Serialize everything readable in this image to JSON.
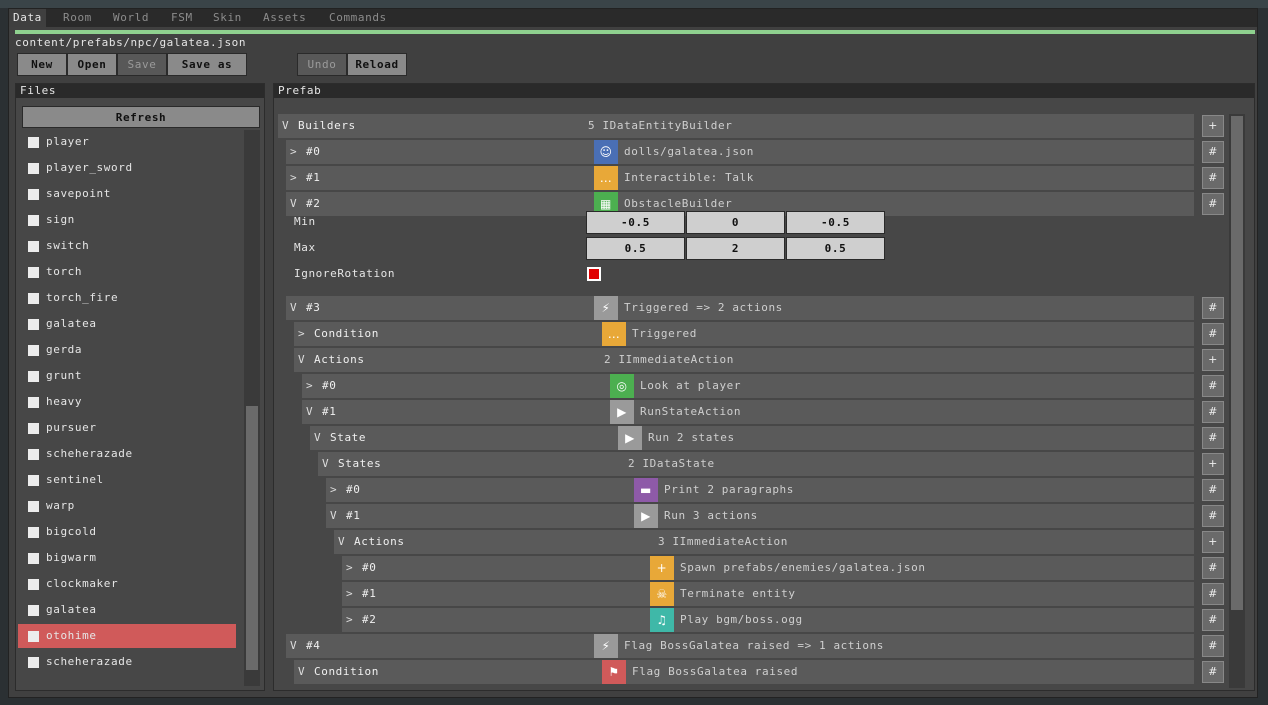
{
  "menu": [
    "Data",
    "Room",
    "World",
    "FSM",
    "Skin",
    "Assets",
    "Commands"
  ],
  "progress": 1.0,
  "path": "content/prefabs/npc/galatea.json",
  "toolbar": {
    "new": "New",
    "open": "Open",
    "save": "Save",
    "save_as": "Save as",
    "undo": "Undo",
    "reload": "Reload"
  },
  "files": {
    "title": "Files",
    "refresh": "Refresh",
    "items": [
      "player",
      "player_sword",
      "savepoint",
      "sign",
      "switch",
      "torch",
      "torch_fire",
      "galatea",
      "gerda",
      "grunt",
      "heavy",
      "pursuer",
      "scheherazade",
      "sentinel",
      "warp",
      "bigcold",
      "bigwarm",
      "clockmaker",
      "galatea",
      "otohime",
      "scheherazade"
    ],
    "selected_index": 19
  },
  "prefab": {
    "title": "Prefab",
    "rows": [
      {
        "caret": "V",
        "label": "Builders",
        "value": "5 IDataEntityBuilder",
        "icon": "",
        "btn": "+"
      },
      {
        "caret": ">",
        "label": "#0",
        "value": "dolls/galatea.json",
        "icon": "person-icon",
        "icon_color": "#4a6fb5",
        "btn": "#"
      },
      {
        "caret": ">",
        "label": "#1",
        "value": "Interactible: Talk",
        "icon": "talk-icon",
        "icon_color": "#e8a838",
        "btn": "#"
      },
      {
        "caret": "V",
        "label": "#2",
        "value": "ObstacleBuilder",
        "icon": "wall-icon",
        "icon_color": "#4caf50",
        "btn": "#"
      },
      {
        "caret": "V",
        "label": "#3",
        "value": "Triggered => 2 actions",
        "icon": "lightning-icon",
        "icon_color": "#9a9a9a",
        "btn": "#"
      },
      {
        "caret": ">",
        "label": "Condition",
        "value": "Triggered",
        "icon": "talk-icon",
        "icon_color": "#e8a838",
        "btn": "#"
      },
      {
        "caret": "V",
        "label": "Actions",
        "value": "2 IImmediateAction",
        "icon": "",
        "btn": "+"
      },
      {
        "caret": ">",
        "label": "#0",
        "value": "Look at player",
        "icon": "look-icon",
        "icon_color": "#4caf50",
        "btn": "#"
      },
      {
        "caret": "V",
        "label": "#1",
        "value": "RunStateAction",
        "icon": "play-icon",
        "icon_color": "#9a9a9a",
        "btn": "#"
      },
      {
        "caret": "V",
        "label": "State",
        "value": "Run 2 states",
        "icon": "play-icon",
        "icon_color": "#9a9a9a",
        "btn": "#"
      },
      {
        "caret": "V",
        "label": "States",
        "value": "2 IDataState",
        "icon": "",
        "btn": "+"
      },
      {
        "caret": ">",
        "label": "#0",
        "value": "Print 2 paragraphs",
        "icon": "speech-icon",
        "icon_color": "#8e5aa8",
        "btn": "#"
      },
      {
        "caret": "V",
        "label": "#1",
        "value": "Run 3 actions",
        "icon": "play-icon",
        "icon_color": "#9a9a9a",
        "btn": "#"
      },
      {
        "caret": "V",
        "label": "Actions",
        "value": "3 IImmediateAction",
        "icon": "",
        "btn": "+"
      },
      {
        "caret": ">",
        "label": "#0",
        "value": "Spawn prefabs/enemies/galatea.json",
        "icon": "plus-icon",
        "icon_color": "#e8a838",
        "btn": "#"
      },
      {
        "caret": ">",
        "label": "#1",
        "value": "Terminate entity",
        "icon": "skull-icon",
        "icon_color": "#e8a838",
        "btn": "#"
      },
      {
        "caret": ">",
        "label": "#2",
        "value": "Play bgm/boss.ogg",
        "icon": "music-icon",
        "icon_color": "#3fb8a8",
        "btn": "#"
      },
      {
        "caret": "V",
        "label": "#4",
        "value": "Flag BossGalatea raised => 1 actions",
        "icon": "lightning-icon",
        "icon_color": "#9a9a9a",
        "btn": "#"
      },
      {
        "caret": "V",
        "label": "Condition",
        "value": "Flag BossGalatea raised",
        "icon": "flag-icon",
        "icon_color": "#d05a5a",
        "btn": "#"
      }
    ],
    "min_label": "Min",
    "max_label": "Max",
    "ignore_rotation_label": "IgnoreRotation",
    "min": [
      "-0.5",
      "0",
      "-0.5"
    ],
    "max": [
      "0.5",
      "2",
      "0.5"
    ],
    "ignore_rotation": true
  }
}
